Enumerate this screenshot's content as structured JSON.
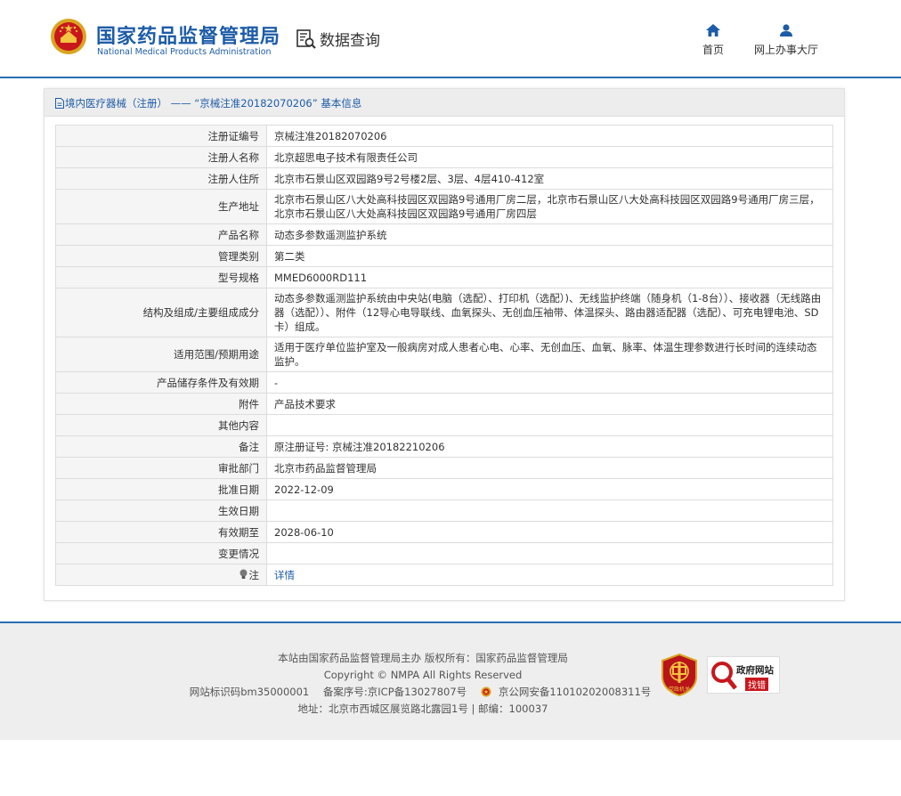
{
  "header": {
    "brand_cn": "国家药品监督管理局",
    "brand_en": "National Medical Products Administration",
    "query_title": "数据查询",
    "nav": [
      {
        "label": "首页",
        "icon": "home-icon"
      },
      {
        "label": "网上办事大厅",
        "icon": "user-icon"
      }
    ],
    "accent_color": "#1d5ca8"
  },
  "breadcrumb": {
    "text": "境内医疗器械（注册） —— “京械注准20182070206” 基本信息",
    "icon": "document-icon"
  },
  "record": {
    "rows": [
      {
        "label": "注册证编号",
        "value": "京械注准20182070206"
      },
      {
        "label": "注册人名称",
        "value": "北京超思电子技术有限责任公司"
      },
      {
        "label": "注册人住所",
        "value": "北京市石景山区双园路9号2号楼2层、3层、4层410-412室"
      },
      {
        "label": "生产地址",
        "value": "北京市石景山区八大处高科技园区双园路9号通用厂房二层，北京市石景山区八大处高科技园区双园路9号通用厂房三层，北京市石景山区八大处高科技园区双园路9号通用厂房四层"
      },
      {
        "label": "产品名称",
        "value": "动态多参数遥测监护系统"
      },
      {
        "label": "管理类别",
        "value": "第二类"
      },
      {
        "label": "型号规格",
        "value": "MMED6000RD111"
      },
      {
        "label": "结构及组成/主要组成成分",
        "value": "动态多参数遥测监护系统由中央站(电脑（选配）、打印机（选配）)、无线监护终端（随身机（1-8台））、接收器（无线路由器（选配））、附件（12导心电导联线、血氧探头、无创血压袖带、体温探头、路由器适配器（选配）、可充电锂电池、SD卡）组成。"
      },
      {
        "label": "适用范围/预期用途",
        "value": "适用于医疗单位监护室及一般病房对成人患者心电、心率、无创血压、血氧、脉率、体温生理参数进行长时间的连续动态监护。"
      },
      {
        "label": "产品储存条件及有效期",
        "value": "-"
      },
      {
        "label": "附件",
        "value": "产品技术要求"
      },
      {
        "label": "其他内容",
        "value": ""
      },
      {
        "label": "备注",
        "value": "原注册证号: 京械注准20182210206"
      },
      {
        "label": "审批部门",
        "value": "北京市药品监督管理局"
      },
      {
        "label": "批准日期",
        "value": "2022-12-09"
      },
      {
        "label": "生效日期",
        "value": ""
      },
      {
        "label": "有效期至",
        "value": "2028-06-10"
      },
      {
        "label": "变更情况",
        "value": ""
      }
    ],
    "note_label": "注",
    "note_link": "详情"
  },
  "footer": {
    "line1": "本站由国家药品监督管理局主办 版权所有：国家药品监督管理局",
    "line2": "Copyright © NMPA All Rights Reserved",
    "site_id": "网站标识码bm35000001",
    "icp": "备案序号:京ICP备13027807号",
    "police": "京公网安备11010202008311号",
    "address": "地址：北京市西城区展览路北露园1号 | 邮编：100037",
    "badge_red_text": "党政机关",
    "badge_gov_title": "政府网站",
    "badge_gov_sub": "找错"
  }
}
